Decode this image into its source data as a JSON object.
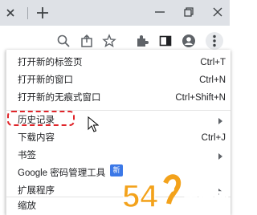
{
  "menu": {
    "items": [
      {
        "label": "打开新的标签页",
        "shortcut": "Ctrl+T"
      },
      {
        "label": "打开新的窗口",
        "shortcut": "Ctrl+N"
      },
      {
        "label": "打开新的无痕式窗口",
        "shortcut": "Ctrl+Shift+N"
      },
      {
        "label": "历史记录",
        "shortcut": ""
      },
      {
        "label": "下载内容",
        "shortcut": "Ctrl+J"
      },
      {
        "label": "书签",
        "shortcut": ""
      },
      {
        "label": "Google 密码管理工具",
        "shortcut": ""
      },
      {
        "label": "扩展程序",
        "shortcut": ""
      },
      {
        "label": "缩放",
        "shortcut": ""
      }
    ],
    "new_badge": "新"
  },
  "colors": {
    "accent_blue": "#3b78e7",
    "highlight_red": "#e0252a",
    "tabstrip_bg": "#dee1e6"
  },
  "watermark": {
    "text_brand": "手游网",
    "text_digits": "54"
  }
}
